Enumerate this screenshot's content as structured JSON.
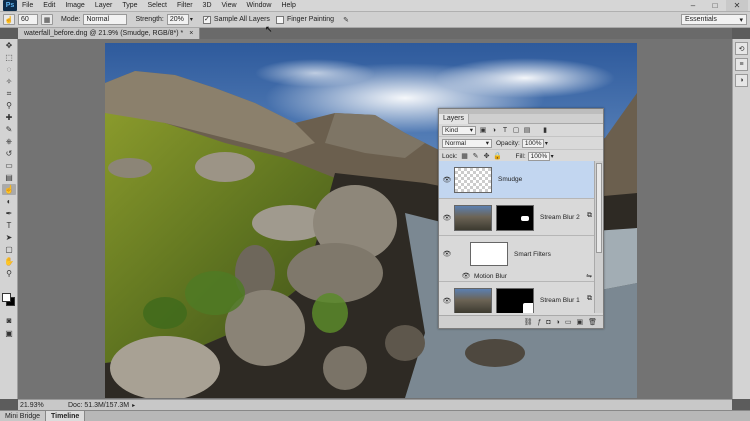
{
  "menubar": {
    "logo": "Ps",
    "items": [
      "File",
      "Edit",
      "Image",
      "Layer",
      "Type",
      "Select",
      "Filter",
      "3D",
      "View",
      "Window",
      "Help"
    ],
    "minimize": "–",
    "maximize": "□",
    "close": "✕"
  },
  "options": {
    "brush_size": "60",
    "mode_label": "Mode:",
    "mode_value": "Normal",
    "strength_label": "Strength:",
    "strength_value": "20%",
    "sample_all_layers": "Sample All Layers",
    "sample_all_checked": "✓",
    "finger_painting": "Finger Painting",
    "workspace": "Essentials"
  },
  "document": {
    "tab_title": "waterfall_before.dng @ 21.9% (Smudge, RGB/8*) *",
    "tab_close": "×"
  },
  "status": {
    "zoom": "21.93%",
    "doc_size": "Doc: 51.3M/157.3M"
  },
  "bottom_tabs": [
    "Mini Bridge",
    "Timeline"
  ],
  "layers_panel": {
    "tab": "Layers",
    "filter_kind": "Kind",
    "blend_mode": "Normal",
    "opacity_label": "Opacity:",
    "opacity_value": "100%",
    "lock_label": "Lock:",
    "fill_label": "Fill:",
    "fill_value": "100%",
    "layers": [
      {
        "name": "Smudge"
      },
      {
        "name": "Stream Blur 2"
      },
      {
        "name": "Smart Filters"
      },
      {
        "name": "Motion Blur"
      },
      {
        "name": "Stream Blur 1"
      }
    ]
  },
  "colors": {
    "selected_layer": "#c2d6f0",
    "app_bg": "#5c5c5c"
  }
}
